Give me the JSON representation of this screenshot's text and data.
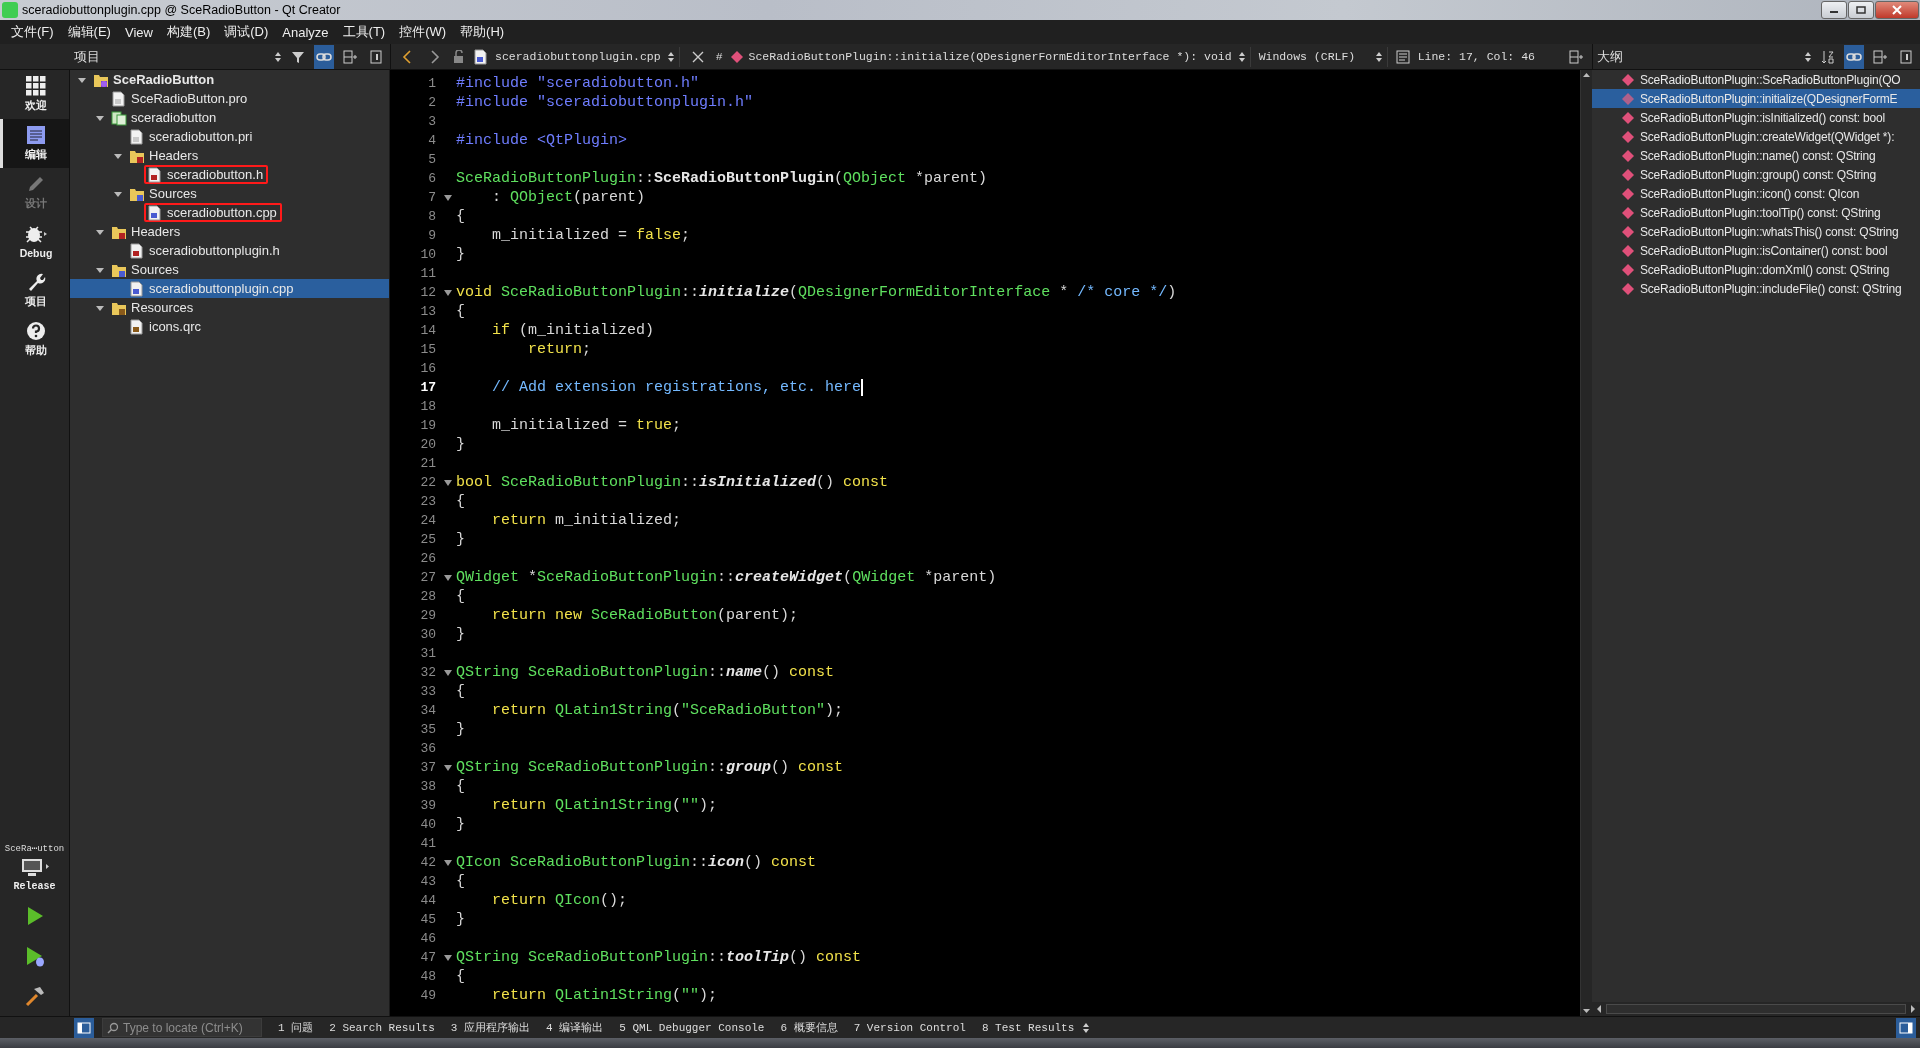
{
  "window": {
    "title": "sceradiobuttonplugin.cpp @ SceRadioButton - Qt Creator"
  },
  "menu": [
    "文件(F)",
    "编辑(E)",
    "View",
    "构建(B)",
    "调试(D)",
    "Analyze",
    "工具(T)",
    "控件(W)",
    "帮助(H)"
  ],
  "modes": [
    {
      "label": "欢迎",
      "kind": "welcome",
      "selected": false,
      "disabled": false
    },
    {
      "label": "编辑",
      "kind": "edit",
      "selected": true,
      "disabled": false
    },
    {
      "label": "设计",
      "kind": "design",
      "selected": false,
      "disabled": true
    },
    {
      "label": "Debug",
      "kind": "debug",
      "selected": false,
      "disabled": false
    },
    {
      "label": "项目",
      "kind": "projects",
      "selected": false,
      "disabled": false
    },
    {
      "label": "帮助",
      "kind": "help",
      "selected": false,
      "disabled": false
    }
  ],
  "kit": {
    "project": "SceRa⋯utton",
    "build": "Release"
  },
  "run_buttons": [
    {
      "kind": "run"
    },
    {
      "kind": "debug"
    },
    {
      "kind": "build"
    }
  ],
  "project_pane": {
    "title": "项目",
    "link_selected": true,
    "items": [
      {
        "label": "SceRadioButton",
        "kind": "project",
        "expanded": true,
        "selected": false,
        "boxed": false,
        "children": [
          {
            "label": "SceRadioButton.pro",
            "kind": "pro",
            "selected": false,
            "boxed": false
          },
          {
            "label": "sceradiobutton",
            "kind": "subproject",
            "expanded": true,
            "selected": false,
            "boxed": false,
            "children": [
              {
                "label": "sceradiobutton.pri",
                "kind": "pro",
                "selected": false,
                "boxed": false
              },
              {
                "label": "Headers",
                "kind": "headers",
                "expanded": true,
                "selected": false,
                "boxed": false,
                "children": [
                  {
                    "label": "sceradiobutton.h",
                    "kind": "header",
                    "selected": false,
                    "boxed": true
                  }
                ]
              },
              {
                "label": "Sources",
                "kind": "sources",
                "expanded": true,
                "selected": false,
                "boxed": false,
                "children": [
                  {
                    "label": "sceradiobutton.cpp",
                    "kind": "source",
                    "selected": false,
                    "boxed": true
                  }
                ]
              }
            ]
          },
          {
            "label": "Headers",
            "kind": "headers",
            "expanded": true,
            "selected": false,
            "boxed": false,
            "children": [
              {
                "label": "sceradiobuttonplugin.h",
                "kind": "header",
                "selected": false,
                "boxed": false
              }
            ]
          },
          {
            "label": "Sources",
            "kind": "sources",
            "expanded": true,
            "selected": false,
            "boxed": false,
            "children": [
              {
                "label": "sceradiobuttonplugin.cpp",
                "kind": "source",
                "selected": true,
                "boxed": false
              }
            ]
          },
          {
            "label": "Resources",
            "kind": "resources",
            "expanded": true,
            "selected": false,
            "boxed": false,
            "children": [
              {
                "label": "icons.qrc",
                "kind": "qrc",
                "selected": false,
                "boxed": false
              }
            ]
          }
        ]
      }
    ]
  },
  "editor": {
    "file": "sceradiobuttonplugin.cpp",
    "symbol_hash": "#",
    "symbol": "SceRadioButtonPlugin::initialize(QDesignerFormEditorInterface *): void",
    "line_ending": "Windows (CRLF)",
    "position": "Line: 17, Col: 46",
    "lines": [
      {
        "number": "1",
        "fold": false,
        "current": false,
        "tokens": [
          {
            "kind": "pp",
            "text": "#include \"sceradiobutton.h\""
          }
        ]
      },
      {
        "number": "2",
        "fold": false,
        "current": false,
        "tokens": [
          {
            "kind": "pp",
            "text": "#include \"sceradiobuttonplugin.h\""
          }
        ]
      },
      {
        "number": "3",
        "fold": false,
        "current": false
      },
      {
        "number": "4",
        "fold": false,
        "current": false,
        "tokens": [
          {
            "kind": "pp",
            "text": "#include <QtPlugin>"
          }
        ]
      },
      {
        "number": "5",
        "fold": false,
        "current": false
      },
      {
        "number": "6",
        "fold": false,
        "current": false,
        "tokens": [
          {
            "kind": "type",
            "text": "SceRadioButtonPlugin"
          },
          {
            "kind": "plain",
            "text": "::"
          },
          {
            "kind": "decl",
            "text": "SceRadioButtonPlugin"
          },
          {
            "kind": "plain",
            "text": "("
          },
          {
            "kind": "type",
            "text": "QObject"
          },
          {
            "kind": "plain",
            "text": " *parent)"
          }
        ]
      },
      {
        "number": "7",
        "fold": true,
        "current": false,
        "tokens": [
          {
            "kind": "plain",
            "text": "    : "
          },
          {
            "kind": "type",
            "text": "QObject"
          },
          {
            "kind": "plain",
            "text": "(parent)"
          }
        ]
      },
      {
        "number": "8",
        "fold": false,
        "current": false,
        "tokens": [
          {
            "kind": "plain",
            "text": "{"
          }
        ]
      },
      {
        "number": "9",
        "fold": false,
        "current": false,
        "tokens": [
          {
            "kind": "plain",
            "text": "    m_initialized = "
          },
          {
            "kind": "kw",
            "text": "false"
          },
          {
            "kind": "plain",
            "text": ";"
          }
        ]
      },
      {
        "number": "10",
        "fold": false,
        "current": false,
        "tokens": [
          {
            "kind": "plain",
            "text": "}"
          }
        ]
      },
      {
        "number": "11",
        "fold": false,
        "current": false
      },
      {
        "number": "12",
        "fold": true,
        "current": false,
        "tokens": [
          {
            "kind": "kw",
            "text": "void "
          },
          {
            "kind": "type",
            "text": "SceRadioButtonPlugin"
          },
          {
            "kind": "plain",
            "text": "::"
          },
          {
            "kind": "func",
            "text": "initialize"
          },
          {
            "kind": "plain",
            "text": "("
          },
          {
            "kind": "type",
            "text": "QDesignerFormEditorInterface"
          },
          {
            "kind": "plain",
            "text": " * "
          },
          {
            "kind": "comment",
            "text": "/* core */"
          },
          {
            "kind": "plain",
            "text": ")"
          }
        ]
      },
      {
        "number": "13",
        "fold": false,
        "current": false,
        "tokens": [
          {
            "kind": "plain",
            "text": "{"
          }
        ]
      },
      {
        "number": "14",
        "fold": false,
        "current": false,
        "tokens": [
          {
            "kind": "kw",
            "text": "    if"
          },
          {
            "kind": "plain",
            "text": " (m_initialized)"
          }
        ]
      },
      {
        "number": "15",
        "fold": false,
        "current": false,
        "tokens": [
          {
            "kind": "kw",
            "text": "        return"
          },
          {
            "kind": "plain",
            "text": ";"
          }
        ]
      },
      {
        "number": "16",
        "fold": false,
        "current": false
      },
      {
        "number": "17",
        "fold": false,
        "current": true,
        "tokens": [
          {
            "kind": "comment",
            "text": "    // Add extension registrations, etc. here"
          }
        ]
      },
      {
        "number": "18",
        "fold": false,
        "current": false
      },
      {
        "number": "19",
        "fold": false,
        "current": false,
        "tokens": [
          {
            "kind": "plain",
            "text": "    m_initialized = "
          },
          {
            "kind": "kw",
            "text": "true"
          },
          {
            "kind": "plain",
            "text": ";"
          }
        ]
      },
      {
        "number": "20",
        "fold": false,
        "current": false,
        "tokens": [
          {
            "kind": "plain",
            "text": "}"
          }
        ]
      },
      {
        "number": "21",
        "fold": false,
        "current": false
      },
      {
        "number": "22",
        "fold": true,
        "current": false,
        "tokens": [
          {
            "kind": "kw",
            "text": "bool "
          },
          {
            "kind": "type",
            "text": "SceRadioButtonPlugin"
          },
          {
            "kind": "plain",
            "text": "::"
          },
          {
            "kind": "func",
            "text": "isInitialized"
          },
          {
            "kind": "plain",
            "text": "() "
          },
          {
            "kind": "kw",
            "text": "const"
          }
        ]
      },
      {
        "number": "23",
        "fold": false,
        "current": false,
        "tokens": [
          {
            "kind": "plain",
            "text": "{"
          }
        ]
      },
      {
        "number": "24",
        "fold": false,
        "current": false,
        "tokens": [
          {
            "kind": "kw",
            "text": "    return"
          },
          {
            "kind": "plain",
            "text": " m_initialized;"
          }
        ]
      },
      {
        "number": "25",
        "fold": false,
        "current": false,
        "tokens": [
          {
            "kind": "plain",
            "text": "}"
          }
        ]
      },
      {
        "number": "26",
        "fold": false,
        "current": false
      },
      {
        "number": "27",
        "fold": true,
        "current": false,
        "tokens": [
          {
            "kind": "type",
            "text": "QWidget"
          },
          {
            "kind": "plain",
            "text": " *"
          },
          {
            "kind": "type",
            "text": "SceRadioButtonPlugin"
          },
          {
            "kind": "plain",
            "text": "::"
          },
          {
            "kind": "func",
            "text": "createWidget"
          },
          {
            "kind": "plain",
            "text": "("
          },
          {
            "kind": "type",
            "text": "QWidget"
          },
          {
            "kind": "plain",
            "text": " *parent)"
          }
        ]
      },
      {
        "number": "28",
        "fold": false,
        "current": false,
        "tokens": [
          {
            "kind": "plain",
            "text": "{"
          }
        ]
      },
      {
        "number": "29",
        "fold": false,
        "current": false,
        "tokens": [
          {
            "kind": "kw",
            "text": "    return new "
          },
          {
            "kind": "type",
            "text": "SceRadioButton"
          },
          {
            "kind": "plain",
            "text": "(parent);"
          }
        ]
      },
      {
        "number": "30",
        "fold": false,
        "current": false,
        "tokens": [
          {
            "kind": "plain",
            "text": "}"
          }
        ]
      },
      {
        "number": "31",
        "fold": false,
        "current": false
      },
      {
        "number": "32",
        "fold": true,
        "current": false,
        "tokens": [
          {
            "kind": "type",
            "text": "QString SceRadioButtonPlugin"
          },
          {
            "kind": "plain",
            "text": "::"
          },
          {
            "kind": "func",
            "text": "name"
          },
          {
            "kind": "plain",
            "text": "() "
          },
          {
            "kind": "kw",
            "text": "const"
          }
        ]
      },
      {
        "number": "33",
        "fold": false,
        "current": false,
        "tokens": [
          {
            "kind": "plain",
            "text": "{"
          }
        ]
      },
      {
        "number": "34",
        "fold": false,
        "current": false,
        "tokens": [
          {
            "kind": "kw",
            "text": "    return "
          },
          {
            "kind": "type",
            "text": "QLatin1String"
          },
          {
            "kind": "plain",
            "text": "("
          },
          {
            "kind": "str",
            "text": "\"SceRadioButton\""
          },
          {
            "kind": "plain",
            "text": ");"
          }
        ]
      },
      {
        "number": "35",
        "fold": false,
        "current": false,
        "tokens": [
          {
            "kind": "plain",
            "text": "}"
          }
        ]
      },
      {
        "number": "36",
        "fold": false,
        "current": false
      },
      {
        "number": "37",
        "fold": true,
        "current": false,
        "tokens": [
          {
            "kind": "type",
            "text": "QString SceRadioButtonPlugin"
          },
          {
            "kind": "plain",
            "text": "::"
          },
          {
            "kind": "func",
            "text": "group"
          },
          {
            "kind": "plain",
            "text": "() "
          },
          {
            "kind": "kw",
            "text": "const"
          }
        ]
      },
      {
        "number": "38",
        "fold": false,
        "current": false,
        "tokens": [
          {
            "kind": "plain",
            "text": "{"
          }
        ]
      },
      {
        "number": "39",
        "fold": false,
        "current": false,
        "tokens": [
          {
            "kind": "kw",
            "text": "    return "
          },
          {
            "kind": "type",
            "text": "QLatin1String"
          },
          {
            "kind": "plain",
            "text": "("
          },
          {
            "kind": "str",
            "text": "\"\""
          },
          {
            "kind": "plain",
            "text": ");"
          }
        ]
      },
      {
        "number": "40",
        "fold": false,
        "current": false,
        "tokens": [
          {
            "kind": "plain",
            "text": "}"
          }
        ]
      },
      {
        "number": "41",
        "fold": false,
        "current": false
      },
      {
        "number": "42",
        "fold": true,
        "current": false,
        "tokens": [
          {
            "kind": "type",
            "text": "QIcon SceRadioButtonPlugin"
          },
          {
            "kind": "plain",
            "text": "::"
          },
          {
            "kind": "func",
            "text": "icon"
          },
          {
            "kind": "plain",
            "text": "() "
          },
          {
            "kind": "kw",
            "text": "const"
          }
        ]
      },
      {
        "number": "43",
        "fold": false,
        "current": false,
        "tokens": [
          {
            "kind": "plain",
            "text": "{"
          }
        ]
      },
      {
        "number": "44",
        "fold": false,
        "current": false,
        "tokens": [
          {
            "kind": "kw",
            "text": "    return "
          },
          {
            "kind": "type",
            "text": "QIcon"
          },
          {
            "kind": "plain",
            "text": "();"
          }
        ]
      },
      {
        "number": "45",
        "fold": false,
        "current": false,
        "tokens": [
          {
            "kind": "plain",
            "text": "}"
          }
        ]
      },
      {
        "number": "46",
        "fold": false,
        "current": false
      },
      {
        "number": "47",
        "fold": true,
        "current": false,
        "tokens": [
          {
            "kind": "type",
            "text": "QString SceRadioButtonPlugin"
          },
          {
            "kind": "plain",
            "text": "::"
          },
          {
            "kind": "func",
            "text": "toolTip"
          },
          {
            "kind": "plain",
            "text": "() "
          },
          {
            "kind": "kw",
            "text": "const"
          }
        ]
      },
      {
        "number": "48",
        "fold": false,
        "current": false,
        "tokens": [
          {
            "kind": "plain",
            "text": "{"
          }
        ]
      },
      {
        "number": "49",
        "fold": false,
        "current": false,
        "tokens": [
          {
            "kind": "kw",
            "text": "    return "
          },
          {
            "kind": "type",
            "text": "QLatin1String"
          },
          {
            "kind": "plain",
            "text": "("
          },
          {
            "kind": "str",
            "text": "\"\""
          },
          {
            "kind": "plain",
            "text": ");"
          }
        ]
      }
    ]
  },
  "outline": {
    "title": "大纲",
    "link_selected": true,
    "items": [
      {
        "label": "SceRadioButtonPlugin::SceRadioButtonPlugin(QO",
        "selected": false
      },
      {
        "label": "SceRadioButtonPlugin::initialize(QDesignerFormE",
        "selected": true
      },
      {
        "label": "SceRadioButtonPlugin::isInitialized() const: bool",
        "selected": false
      },
      {
        "label": "SceRadioButtonPlugin::createWidget(QWidget *):",
        "selected": false
      },
      {
        "label": "SceRadioButtonPlugin::name() const: QString",
        "selected": false
      },
      {
        "label": "SceRadioButtonPlugin::group() const: QString",
        "selected": false
      },
      {
        "label": "SceRadioButtonPlugin::icon() const: QIcon",
        "selected": false
      },
      {
        "label": "SceRadioButtonPlugin::toolTip() const: QString",
        "selected": false
      },
      {
        "label": "SceRadioButtonPlugin::whatsThis() const: QString",
        "selected": false
      },
      {
        "label": "SceRadioButtonPlugin::isContainer() const: bool",
        "selected": false
      },
      {
        "label": "SceRadioButtonPlugin::domXml() const: QString",
        "selected": false
      },
      {
        "label": "SceRadioButtonPlugin::includeFile() const: QString",
        "selected": false
      }
    ]
  },
  "bottom_bar": {
    "search_placeholder": "Type to locate (Ctrl+K)",
    "tabs": [
      "1 问题",
      "2 Search Results",
      "3 应用程序输出",
      "4 编译输出",
      "5 QML Debugger Console",
      "6 概要信息",
      "7 Version Control",
      "8 Test Results"
    ]
  }
}
